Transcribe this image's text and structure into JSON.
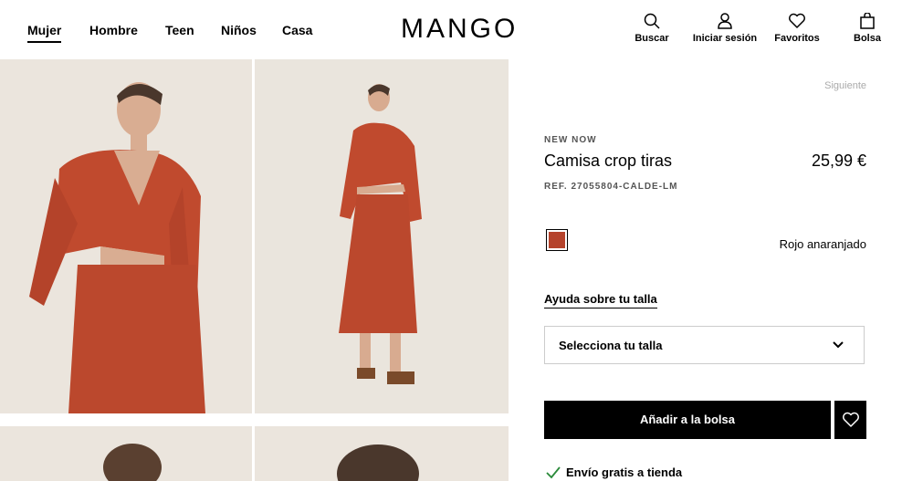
{
  "header": {
    "nav": [
      "Mujer",
      "Hombre",
      "Teen",
      "Niños",
      "Casa"
    ],
    "active_nav": "Mujer",
    "logo": "MANGO",
    "tools": {
      "search": "Buscar",
      "login": "Iniciar sesión",
      "favorites": "Favoritos",
      "bag": "Bolsa"
    }
  },
  "product": {
    "next_label": "Siguiente",
    "badge": "NEW NOW",
    "name": "Camisa crop tiras",
    "price": "25,99 €",
    "ref": "REF. 27055804-CALDE-LM",
    "color_name": "Rojo anaranjado",
    "color_hex": "#b5432c",
    "size_help": "Ayuda sobre tu talla",
    "size_select_placeholder": "Selecciona tu talla",
    "add_to_bag": "Añadir a la bolsa",
    "shipping": "Envío gratis a tienda"
  }
}
